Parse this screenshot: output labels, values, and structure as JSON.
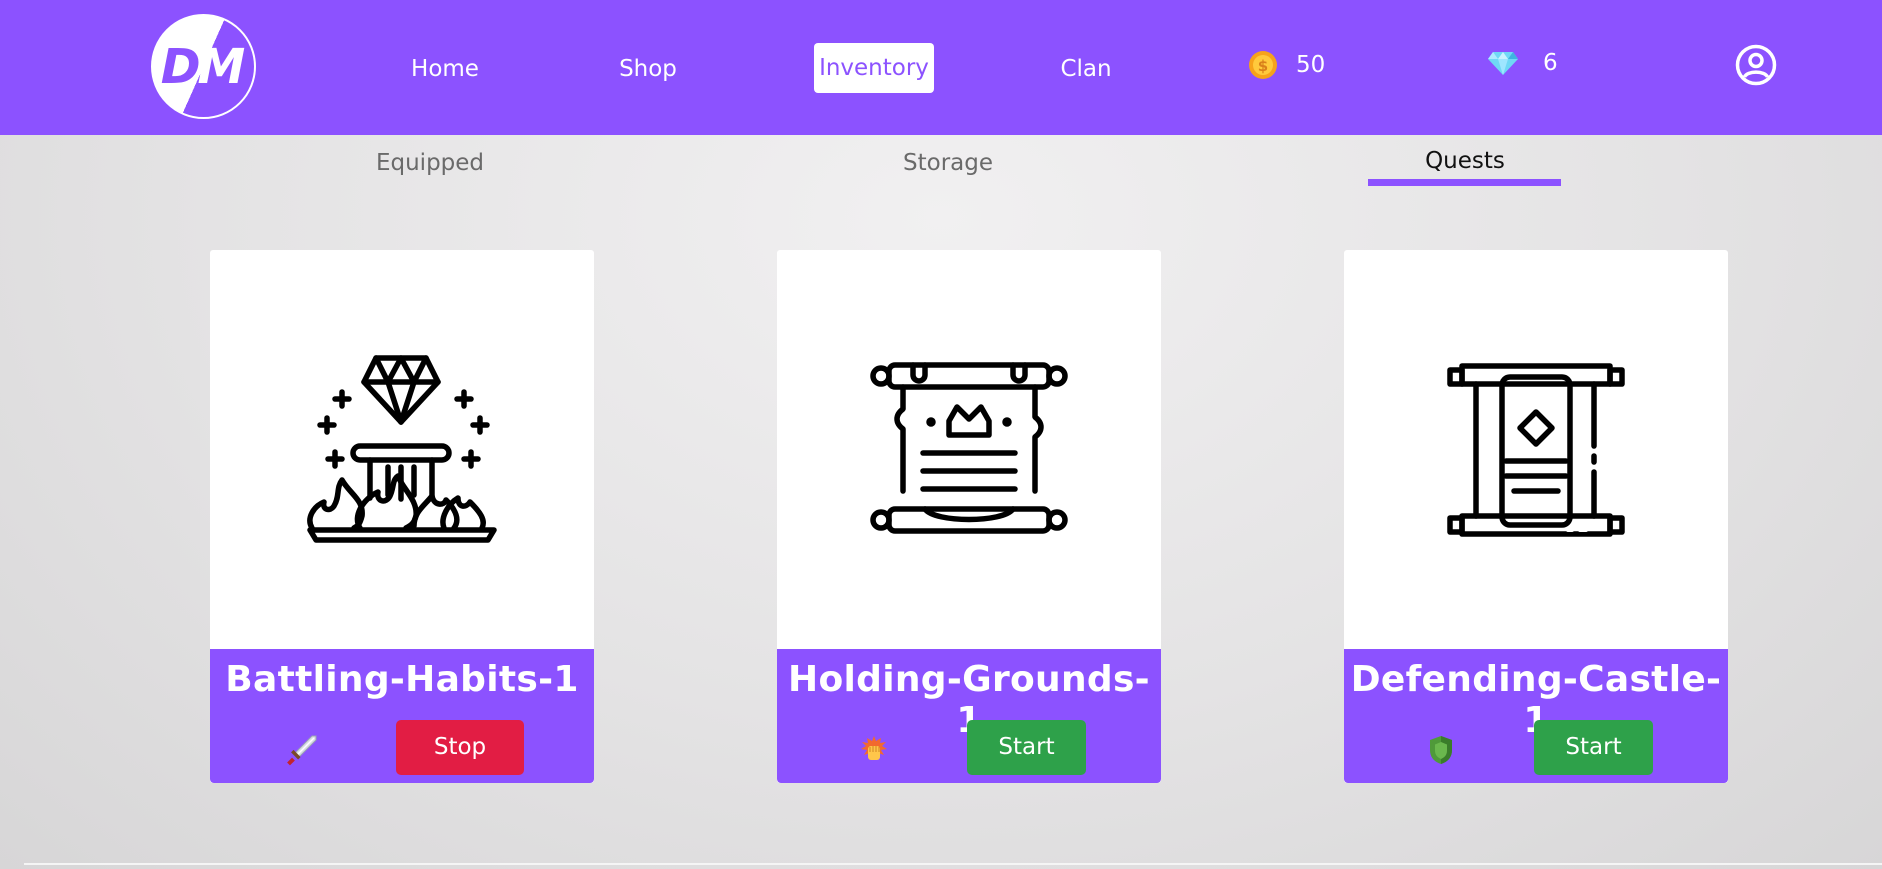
{
  "header": {
    "logo_text_left": "D",
    "logo_text_right": "M",
    "nav": [
      {
        "label": "Home"
      },
      {
        "label": "Shop"
      },
      {
        "label": "Inventory",
        "active": true
      },
      {
        "label": "Clan"
      }
    ],
    "coins": {
      "icon": "coin-icon",
      "value": "50"
    },
    "gems": {
      "icon": "gem-icon",
      "value": "6"
    },
    "profile_icon": "user-circle-icon"
  },
  "tabs": [
    {
      "label": "Equipped"
    },
    {
      "label": "Storage"
    },
    {
      "label": "Quests",
      "active": true
    }
  ],
  "quests": [
    {
      "title": "Battling-Habits-1",
      "icon": "diamond-pillar-icon",
      "badge": "sword-icon",
      "action": "Stop"
    },
    {
      "title": "Holding-Grounds-1",
      "icon": "crown-scroll-icon",
      "badge": "fist-icon",
      "action": "Start"
    },
    {
      "title": "Defending-Castle-1",
      "icon": "rune-scroll-icon",
      "badge": "shield-icon",
      "action": "Start"
    }
  ],
  "colors": {
    "brand": "#8c52ff",
    "stop": "#e21d44",
    "start": "#2ea14a"
  }
}
